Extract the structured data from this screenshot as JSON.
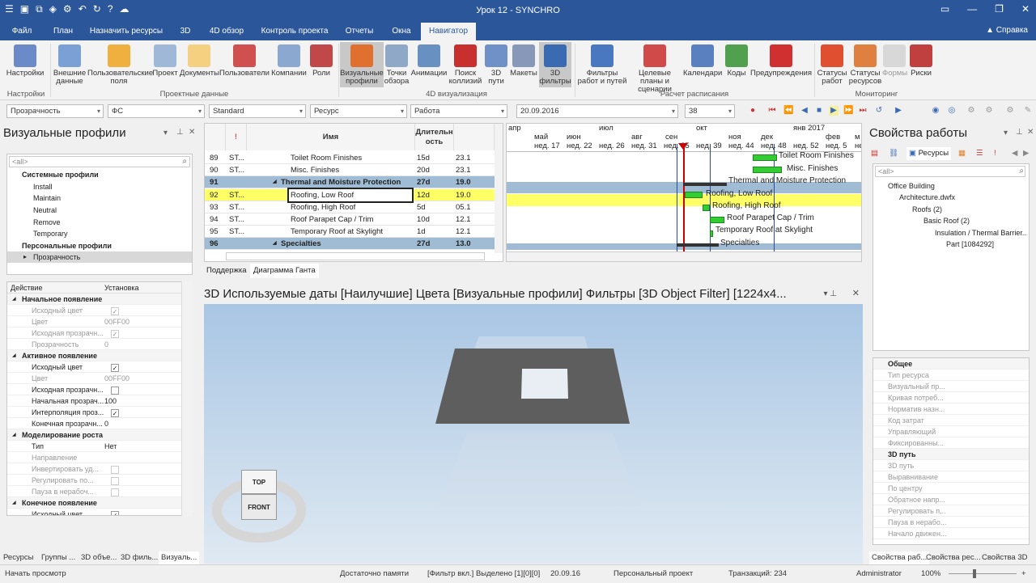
{
  "window": {
    "title": "Урок 12 - SYNCHRO"
  },
  "menu": {
    "tabs": [
      "Файл",
      "План",
      "Назначить ресурсы",
      "3D",
      "4D обзор",
      "Контроль проекта",
      "Отчеты",
      "Окна",
      "Навигатор"
    ],
    "active": "Навигатор",
    "help": "Справка"
  },
  "ribbon": {
    "buttons": [
      "Настройки",
      "Внешние данные",
      "Пользовательские поля",
      "Проект",
      "Документы",
      "Пользователи",
      "Компании",
      "Роли",
      "Визуальные профили",
      "Точки обзора",
      "Анимации",
      "Поиск коллизий",
      "3D пути",
      "Макеты",
      "3D фильтры",
      "Фильтры работ и путей",
      "Целевые планы и сценарии",
      "Календари",
      "Коды",
      "Предупреждения",
      "Статусы работ",
      "Статусы ресурсов",
      "Формы",
      "Риски"
    ],
    "groups": [
      "Настройки",
      "Проектные данные",
      "4D визуализация",
      "Расчет расписания",
      "Мониторинг"
    ]
  },
  "filterbar": {
    "transparency": "Прозрачность",
    "fs": "ФС",
    "standard": "Standard",
    "resource": "Ресурс",
    "work": "Работа",
    "date": "20.09.2016",
    "zoom": "38"
  },
  "left_panel": {
    "title": "Визуальные профили",
    "search_placeholder": "<all>",
    "tree": {
      "system_header": "Системные профили",
      "system_items": [
        "Install",
        "Maintain",
        "Neutral",
        "Remove",
        "Temporary"
      ],
      "personal_header": "Персональные профили",
      "personal_items": [
        "Прозрачность"
      ]
    },
    "props_header": {
      "action": "Действие",
      "setting": "Установка"
    },
    "props": [
      {
        "kind": "h",
        "key": "Начальное появление"
      },
      {
        "kind": "r",
        "key": "Исходный цвет",
        "val": "",
        "chk": "✓",
        "dim": true
      },
      {
        "kind": "r",
        "key": "Цвет",
        "val": "00FF00",
        "chk": "",
        "dim": true
      },
      {
        "kind": "r",
        "key": "Исходная прозрачн...",
        "val": "",
        "chk": "✓",
        "dim": true
      },
      {
        "kind": "r",
        "key": "Прозрачность",
        "val": "0",
        "chk": "",
        "dim": true
      },
      {
        "kind": "h",
        "key": "Активное появление"
      },
      {
        "kind": "r",
        "key": "Исходный цвет",
        "val": "",
        "chk": "✓",
        "dim": false
      },
      {
        "kind": "r",
        "key": "Цвет",
        "val": "00FF00",
        "chk": "",
        "dim": true
      },
      {
        "kind": "r",
        "key": "Исходная прозрачн...",
        "val": "",
        "chk": " ",
        "dim": false
      },
      {
        "kind": "r",
        "key": "Начальная прозрач...",
        "val": "100",
        "chk": "",
        "dim": false
      },
      {
        "kind": "r",
        "key": "Интерполяция проз...",
        "val": "",
        "chk": "✓",
        "dim": false
      },
      {
        "kind": "r",
        "key": "Конечная прозрачн...",
        "val": "0",
        "chk": "",
        "dim": false
      },
      {
        "kind": "h",
        "key": "Моделирование роста"
      },
      {
        "kind": "r",
        "key": "Тип",
        "val": "Нет",
        "chk": "",
        "dim": false
      },
      {
        "kind": "r",
        "key": "Направление",
        "val": "",
        "chk": "",
        "dim": true
      },
      {
        "kind": "r",
        "key": "Инвертировать уд...",
        "val": "",
        "chk": " ",
        "dim": true
      },
      {
        "kind": "r",
        "key": "Регулировать по...",
        "val": "",
        "chk": " ",
        "dim": true
      },
      {
        "kind": "r",
        "key": "Пауза в нерабоч...",
        "val": "",
        "chk": " ",
        "dim": true
      },
      {
        "kind": "h",
        "key": "Конечное появление"
      },
      {
        "kind": "r",
        "key": "Исходный цвет",
        "val": "",
        "chk": "✓",
        "dim": false
      }
    ],
    "bottom_tabs": [
      "Ресурсы",
      "Группы ...",
      "3D объе...",
      "3D филь...",
      "Визуаль..."
    ]
  },
  "grid": {
    "headers": {
      "icon": "!",
      "name": "Имя",
      "duration": "Длительн ость"
    },
    "rows": [
      {
        "n": "89",
        "id": "ST...",
        "name": "Toilet Room Finishes",
        "dur": "15d",
        "start": "23.1",
        "type": "normal"
      },
      {
        "n": "90",
        "id": "ST...",
        "name": "Misc. Finishes",
        "dur": "20d",
        "start": "23.1",
        "type": "normal"
      },
      {
        "n": "91",
        "id": "",
        "name": "Thermal and Moisture Protection",
        "dur": "27d",
        "start": "19.0",
        "type": "summary"
      },
      {
        "n": "92",
        "id": "ST...",
        "name": "Roofing, Low Roof",
        "dur": "12d",
        "start": "19.0",
        "type": "selected"
      },
      {
        "n": "93",
        "id": "ST...",
        "name": "Roofing, High Roof",
        "dur": "5d",
        "start": "05.1",
        "type": "normal"
      },
      {
        "n": "94",
        "id": "ST...",
        "name": "Roof Parapet Cap / Trim",
        "dur": "10d",
        "start": "12.1",
        "type": "normal"
      },
      {
        "n": "95",
        "id": "ST...",
        "name": "Temporary Roof at Skylight",
        "dur": "1d",
        "start": "12.1",
        "type": "normal"
      },
      {
        "n": "96",
        "id": "",
        "name": "Specialties",
        "dur": "27d",
        "start": "13.0",
        "type": "summary"
      }
    ],
    "tabs": [
      "Поддержка",
      "Диаграмма Ганта"
    ]
  },
  "gantt": {
    "months": [
      "апр",
      "май",
      "июн",
      "июл",
      "авг",
      "сен",
      "окт",
      "ноя",
      "дек",
      "янв 2017",
      "фев",
      "м"
    ],
    "weeks": [
      "нед. 17",
      "нед. 22",
      "нед. 26",
      "нед. 31",
      "нед. 35",
      "нед. 39",
      "нед. 44",
      "нед. 48",
      "нед. 52",
      "нед. 5",
      "нед"
    ],
    "labels": [
      "Toilet Room Finishes",
      "Misc. Finishes",
      "Thermal and Moisture Protection",
      "Roofing, Low Roof",
      "Roofing, High Roof",
      "Roof Parapet Cap / Trim",
      "Temporary Roof at Skylight",
      "Specialties"
    ]
  },
  "view3d": {
    "title": "3D Используемые даты [Наилучшие] Цвета [Визуальные профили] Фильтры [3D Object Filter]  [1224x4...",
    "cube_top": "TOP",
    "cube_front": "FRONT"
  },
  "right_panel": {
    "title": "Свойства работы",
    "tab_resources": "Ресурсы",
    "search_placeholder": "<all>",
    "tree": [
      "Office Building",
      "Architecture.dwfx",
      "Roofs (2)",
      "Basic Roof (2)",
      "Insulation / Thermal Barrier...",
      "Part [1084292]"
    ],
    "sections": [
      {
        "title": "Общее",
        "items": [
          "Тип ресурса",
          "Визуальный пр...",
          "Кривая потреб...",
          "Норматив назн...",
          "Код затрат",
          "Управляющий",
          "Фиксированны..."
        ]
      },
      {
        "title": "3D путь",
        "items": [
          "3D путь",
          "Выравнивание",
          "По центру",
          "Обратное напр...",
          "Регулировать п...",
          "Пауза в нерабо...",
          "Начало движен..."
        ]
      }
    ],
    "bottom_tabs": [
      "Свойства раб...",
      "Свойства рес...",
      "Свойства 3D ..."
    ]
  },
  "statusbar": {
    "left": "Начать просмотр",
    "memory": "Достаточно памяти",
    "filter": "[Фильтр вкл.] Выделено [1][0][0]",
    "date": "20.09.16",
    "project": "Персональный проект",
    "transactions": "Транзакций: 234",
    "user": "Administrator",
    "zoom": "100%"
  },
  "colors": {
    "accent": "#2b579a",
    "summary_row": "#9fbcd4",
    "selected_row": "#ffff66",
    "bar": "#33cc33"
  }
}
